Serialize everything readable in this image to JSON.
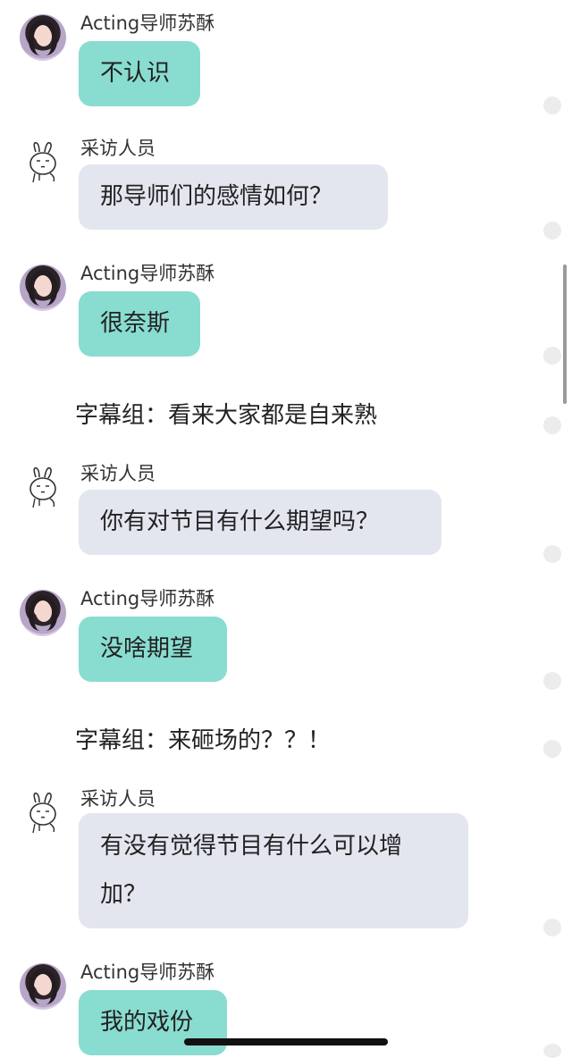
{
  "senders": {
    "acting": "Acting导师苏酥",
    "interviewer": "采访人员"
  },
  "messages": [
    {
      "sender": "Acting导师苏酥",
      "text": "不认识"
    },
    {
      "sender": "采访人员",
      "text": "那导师们的感情如何？"
    },
    {
      "sender": "Acting导师苏酥",
      "text": "很奈斯"
    },
    {
      "caption": "字幕组：看来大家都是自来熟"
    },
    {
      "sender": "采访人员",
      "text": "你有对节目有什么期望吗？"
    },
    {
      "sender": "Acting导师苏酥",
      "text": "没啥期望"
    },
    {
      "caption": "字幕组：来砸场的？？！"
    },
    {
      "sender": "采访人员",
      "text": [
        "有没有觉得节目有什么可以增",
        "加？"
      ]
    },
    {
      "sender": "Acting导师苏酥",
      "text": "我的戏份"
    }
  ],
  "colors": {
    "acting_bubble": "#89dcd0",
    "interviewer_bubble": "#e3e6ef",
    "background": "#ffffff"
  },
  "icons": {
    "acting_avatar": "profile-photo",
    "interviewer_avatar": "rabbit-doodle"
  }
}
